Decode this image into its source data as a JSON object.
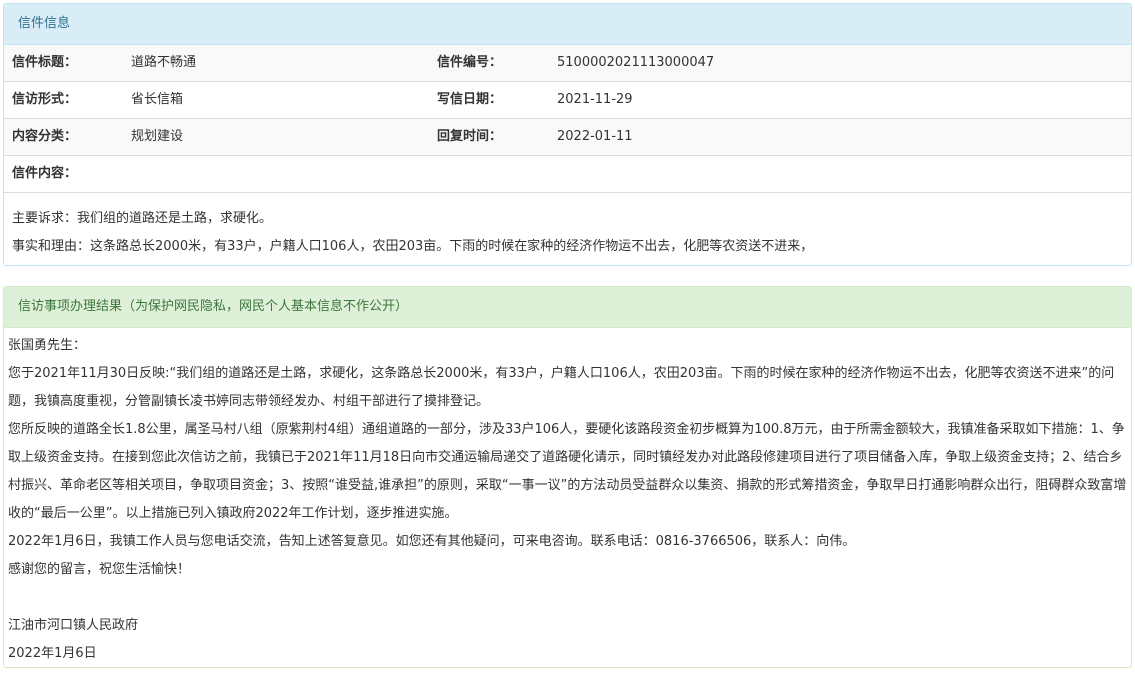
{
  "letter_panel": {
    "heading": "信件信息",
    "rows": [
      {
        "label1": "信件标题：",
        "value1": "道路不畅通",
        "label2": "信件编号：",
        "value2": "510000202111300004​7"
      },
      {
        "label1": "信访形式：",
        "value1": "省长信箱",
        "label2": "写信日期：",
        "value2": "2021-11-29"
      },
      {
        "label1": "内容分类：",
        "value1": "规划建设",
        "label2": "回复时间：",
        "value2": "2022-01-11"
      }
    ],
    "content_label": "信件内容：",
    "content_lines": [
      "主要诉求：我们组的道路还是土路，求硬化。",
      "事实和理由：这条路总长2000米，有33户，户籍人口106人，农田203亩。下雨的时候在家种的经济作物运不出去，化肥等农资送不进来，"
    ]
  },
  "result_panel": {
    "heading": "信访事项办理结果（为保护网民隐私，网民个人基本信息不作公开）",
    "paragraphs": [
      "张国勇先生：",
      "您于2021年11月30日反映:“我们组的道路还是土路，求硬化，这条路总长2000米，有33户，户籍人口106人，农田203亩。下雨的时候在家种的经济作物运不出去，化肥等农资送不进来”的问题，我镇高度重视，分管副镇长凌书婷同志带领经发办、村组干部进行了摸排登记。",
      "您所反映的道路全长1.8公里，属圣马村八组（原紫荆村4组）通组道路的一部分，涉及33户106人，要硬化该路段资金初步概算为100.8万元，由于所需金额较大，我镇准备采取如下措施：1、争取上级资金支持。在接到您此次信访之前，我镇已于2021年11月18日向市交通运输局递交了道路硬化请示，同时镇经发办对此路段修建项目进行了项目储备入库，争取上级资金支持；2、结合乡村振兴、革命老区等相关项目，争取项目资金；3、按照“谁受益,谁承担”的原则，采取“一事一议”的方法动员受益群众以集资、捐款的形式筹措资金，争取早日打通影响群众出行，阻碍群众致富增收的“最后一公里”。以上措施已列入镇政府2022年工作计划，逐步推进实施。",
      "2022年1月6日，我镇工作人员与您电话交流，告知上述答复意见。如您还有其他疑问，可来电咨询。联系电话：0816-3766506，联系人：向伟。",
      "感谢您的留言，祝您生活愉快！",
      "",
      "江油市河口镇人民政府",
      "2022年1月6日"
    ]
  }
}
